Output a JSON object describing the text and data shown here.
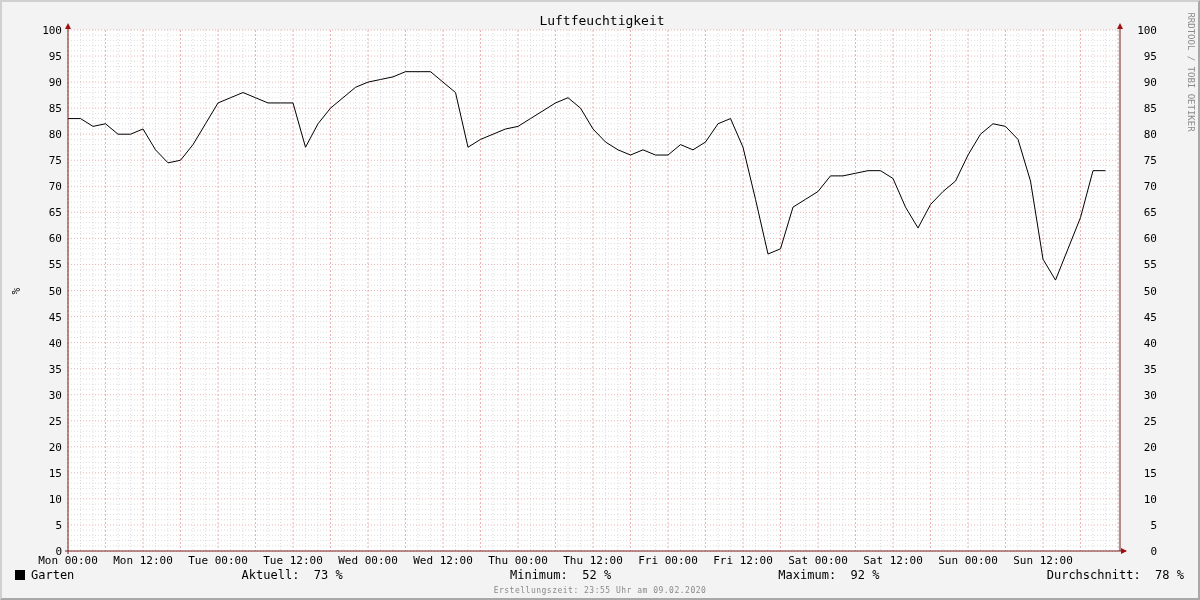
{
  "chart": {
    "chart_data": {
      "type": "line",
      "title": "Luftfeuchtigkeit",
      "ylabel": "%",
      "ylim": [
        0,
        100
      ],
      "grid": true,
      "categories": [
        "Mon 00:00",
        null,
        null,
        null,
        null,
        null,
        "Mon 12:00",
        null,
        null,
        null,
        null,
        null,
        "Tue 00:00",
        null,
        null,
        null,
        null,
        null,
        "Tue 12:00",
        null,
        null,
        null,
        null,
        null,
        "Wed 00:00",
        null,
        null,
        null,
        null,
        null,
        "Wed 12:00",
        null,
        null,
        null,
        null,
        null,
        "Thu 00:00",
        null,
        null,
        null,
        null,
        null,
        "Thu 12:00",
        null,
        null,
        null,
        null,
        null,
        "Fri 00:00",
        null,
        null,
        null,
        null,
        null,
        "Fri 12:00",
        null,
        null,
        null,
        null,
        null,
        "Sat 00:00",
        null,
        null,
        null,
        null,
        null,
        "Sat 12:00",
        null,
        null,
        null,
        null,
        null,
        "Sun 00:00",
        null,
        null,
        null,
        null,
        null,
        "Sun 12:00",
        null,
        null,
        null,
        null,
        null
      ],
      "yticks": [
        0,
        5,
        10,
        15,
        20,
        25,
        30,
        35,
        40,
        45,
        50,
        55,
        60,
        65,
        70,
        75,
        80,
        85,
        90,
        95,
        100
      ],
      "series": [
        {
          "name": "Garten",
          "color": "#000000",
          "values": [
            83,
            83,
            81.5,
            82,
            80,
            80,
            81,
            77,
            74.5,
            75,
            78,
            82,
            86,
            87,
            88,
            87,
            86,
            86,
            86,
            77.5,
            82,
            85,
            87,
            89,
            90,
            90.5,
            91,
            92,
            92,
            92,
            90,
            88,
            77.5,
            79,
            80,
            81,
            81.5,
            83,
            84.5,
            86,
            87,
            85,
            81,
            78.5,
            77,
            76,
            77,
            76,
            76,
            78,
            77,
            78.5,
            82,
            83,
            77.5,
            67.5,
            57,
            58,
            66,
            67.5,
            69,
            72,
            72,
            72.5,
            73,
            73,
            71.5,
            66,
            62,
            66.5,
            69,
            71,
            76,
            80,
            82,
            81.5,
            79,
            71,
            56,
            52,
            58,
            64,
            73,
            73
          ]
        }
      ]
    },
    "right_axis_labels": [
      "100",
      "95",
      "90",
      "85",
      "80",
      "75",
      "70",
      "65",
      "60",
      "55",
      "50",
      "45",
      "40",
      "35",
      "30",
      "25",
      "20",
      "15",
      "10",
      "5",
      "0"
    ],
    "side_credit": "RRDTOOL / TOBI OETIKER"
  },
  "legend": {
    "stats": [
      {
        "label": "Aktuell:",
        "value": "73 %"
      },
      {
        "label": "Minimum:",
        "value": "52 %"
      },
      {
        "label": "Maximum:",
        "value": "92 %"
      },
      {
        "label": "Durchschnitt:",
        "value": "78 %"
      }
    ]
  },
  "footer": "Erstellungszeit: 23:55 Uhr am 09.02.2020"
}
